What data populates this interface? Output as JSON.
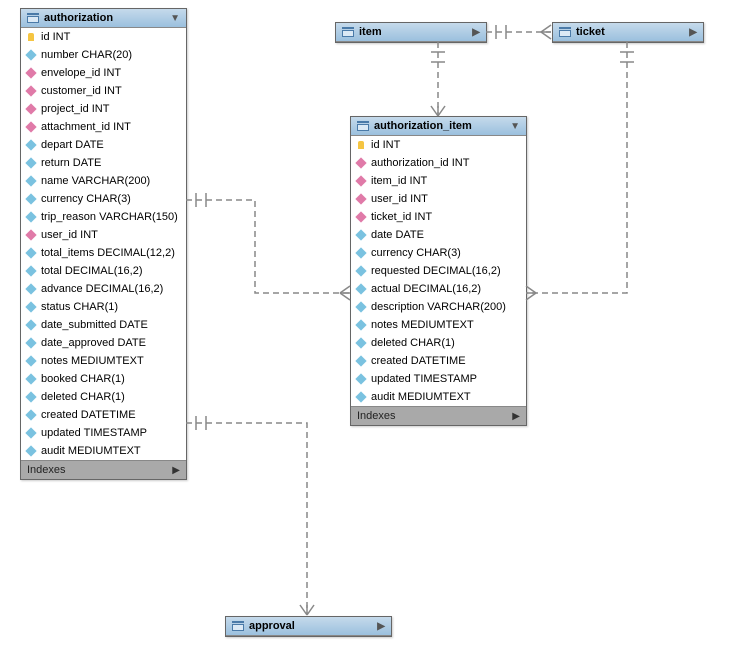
{
  "entities": {
    "authorization": {
      "title": "authorization",
      "footer": "Indexes",
      "columns": [
        {
          "icon": "key",
          "label": "id INT"
        },
        {
          "icon": "fld",
          "label": "number CHAR(20)"
        },
        {
          "icon": "fk",
          "label": "envelope_id INT"
        },
        {
          "icon": "fk",
          "label": "customer_id INT"
        },
        {
          "icon": "fk",
          "label": "project_id INT"
        },
        {
          "icon": "fk",
          "label": "attachment_id INT"
        },
        {
          "icon": "fld",
          "label": "depart DATE"
        },
        {
          "icon": "fld",
          "label": "return DATE"
        },
        {
          "icon": "fld",
          "label": "name VARCHAR(200)"
        },
        {
          "icon": "fld",
          "label": "currency CHAR(3)"
        },
        {
          "icon": "fld",
          "label": "trip_reason VARCHAR(150)"
        },
        {
          "icon": "fk",
          "label": "user_id INT"
        },
        {
          "icon": "fld",
          "label": "total_items DECIMAL(12,2)"
        },
        {
          "icon": "fld",
          "label": "total DECIMAL(16,2)"
        },
        {
          "icon": "fld",
          "label": "advance DECIMAL(16,2)"
        },
        {
          "icon": "fld",
          "label": "status CHAR(1)"
        },
        {
          "icon": "fld",
          "label": "date_submitted DATE"
        },
        {
          "icon": "fld",
          "label": "date_approved DATE"
        },
        {
          "icon": "fld",
          "label": "notes MEDIUMTEXT"
        },
        {
          "icon": "fld",
          "label": "booked CHAR(1)"
        },
        {
          "icon": "fld",
          "label": "deleted CHAR(1)"
        },
        {
          "icon": "fld",
          "label": "created DATETIME"
        },
        {
          "icon": "fld",
          "label": "updated TIMESTAMP"
        },
        {
          "icon": "fld",
          "label": "audit MEDIUMTEXT"
        }
      ]
    },
    "authorization_item": {
      "title": "authorization_item",
      "footer": "Indexes",
      "columns": [
        {
          "icon": "key",
          "label": "id INT"
        },
        {
          "icon": "fk",
          "label": "authorization_id INT"
        },
        {
          "icon": "fk",
          "label": "item_id INT"
        },
        {
          "icon": "fk",
          "label": "user_id INT"
        },
        {
          "icon": "fk",
          "label": "ticket_id INT"
        },
        {
          "icon": "fld",
          "label": "date DATE"
        },
        {
          "icon": "fld",
          "label": "currency CHAR(3)"
        },
        {
          "icon": "fld",
          "label": "requested DECIMAL(16,2)"
        },
        {
          "icon": "fld",
          "label": "actual DECIMAL(16,2)"
        },
        {
          "icon": "fld",
          "label": "description VARCHAR(200)"
        },
        {
          "icon": "fld",
          "label": "notes MEDIUMTEXT"
        },
        {
          "icon": "fld",
          "label": "deleted CHAR(1)"
        },
        {
          "icon": "fld",
          "label": "created DATETIME"
        },
        {
          "icon": "fld",
          "label": "updated TIMESTAMP"
        },
        {
          "icon": "fld",
          "label": "audit MEDIUMTEXT"
        }
      ]
    },
    "item": {
      "title": "item"
    },
    "ticket": {
      "title": "ticket"
    },
    "approval": {
      "title": "approval"
    }
  }
}
